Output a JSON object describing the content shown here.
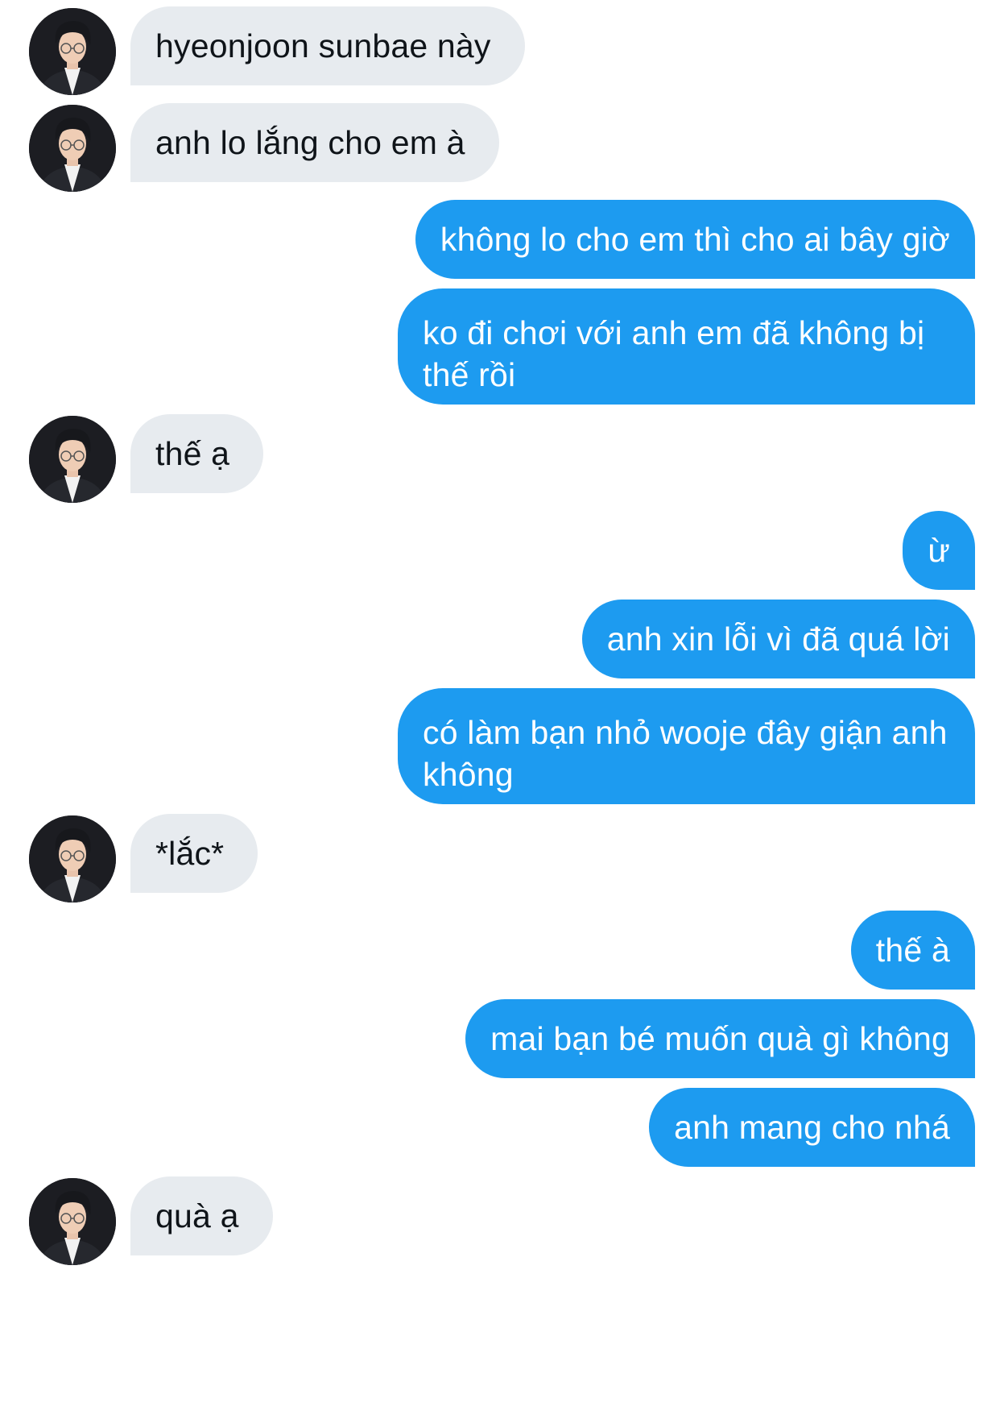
{
  "conversation": {
    "messages": [
      {
        "from": "them",
        "text": "hyeonjoon sunbae này"
      },
      {
        "from": "them",
        "text": "anh lo lắng cho em à"
      },
      {
        "from": "me",
        "text": "không lo cho em thì cho ai bây giờ"
      },
      {
        "from": "me",
        "text": "ko đi chơi với anh em đã không bị thế rồi"
      },
      {
        "from": "them",
        "text": "thế ạ"
      },
      {
        "from": "me",
        "text": "ừ"
      },
      {
        "from": "me",
        "text": "anh xin lỗi vì đã quá lời"
      },
      {
        "from": "me",
        "text": "có làm bạn nhỏ wooje đây giận anh không"
      },
      {
        "from": "them",
        "text": "*lắc*"
      },
      {
        "from": "me",
        "text": "thế à"
      },
      {
        "from": "me",
        "text": "mai bạn bé muốn quà gì không"
      },
      {
        "from": "me",
        "text": "anh mang cho nhá"
      },
      {
        "from": "them",
        "text": "quà ạ"
      }
    ]
  },
  "colors": {
    "outgoing_bubble": "#1d9bf0",
    "incoming_bubble": "#e7ebef",
    "outgoing_text": "#ffffff",
    "incoming_text": "#0f1419",
    "background": "#ffffff"
  },
  "icons": {
    "avatar": "contact-avatar-photo"
  }
}
